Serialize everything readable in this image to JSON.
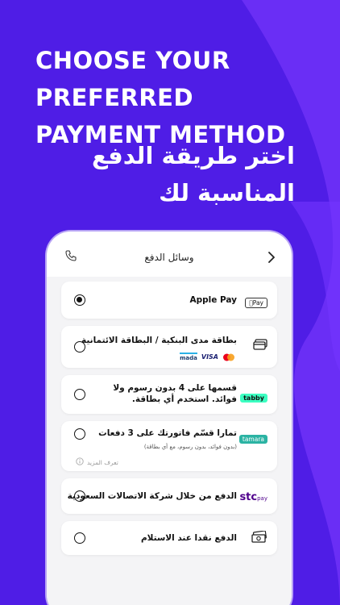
{
  "headline": {
    "en": "CHOOSE YOUR PREFERRED PAYMENT METHOD",
    "ar_line1": "اختر طريقة الدفع",
    "ar_line2": "المناسبة لك"
  },
  "screen": {
    "title": "وسائل الدفع"
  },
  "methods": [
    {
      "label": "Apple Pay",
      "logo": "Pay",
      "selected": true
    },
    {
      "label": "بطاقة مدى البنكية / البطاقة الائتمانية",
      "logos": [
        "mastercard-icon",
        "VISA",
        "mada"
      ]
    },
    {
      "label": "قسمها على 4 بدون رسوم ولا فوائد. استخدم أي بطاقة.",
      "logo": "tabby"
    },
    {
      "label": "تمارا قسّم فاتورتك على 3 دفعات",
      "sub": "(بدون فوائد، بدون رسوم، مع أي بطاقة)",
      "more": "تعرف المزيد",
      "logo": "tamara"
    },
    {
      "label": "الدفع من خلال شركة الاتصالات السعودية",
      "logo": "stc",
      "logo_sub": "pay"
    },
    {
      "label": "الدفع نقدا عند الاستلام",
      "logo": "cash-icon"
    }
  ],
  "colors": {
    "background": "#4f1de6",
    "wave": "#6a2ef5",
    "tabby": "#3bffc1",
    "tamara": "#2bb3a3",
    "stc": "#4f008c"
  }
}
